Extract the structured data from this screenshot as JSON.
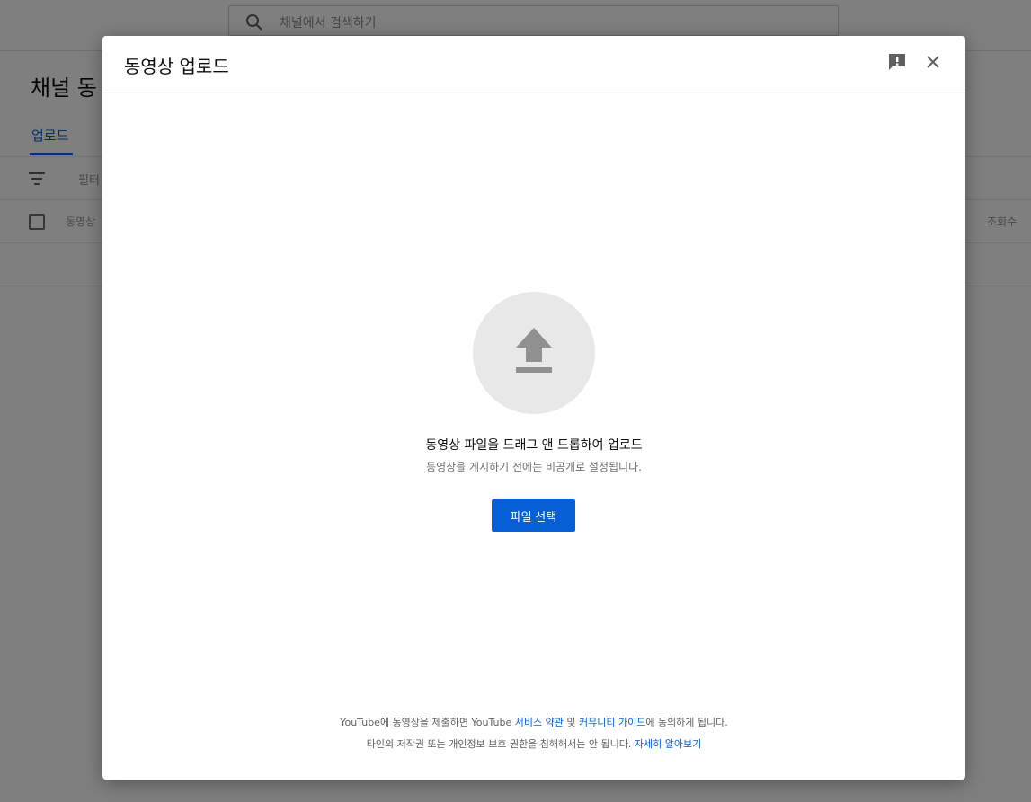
{
  "background": {
    "search_placeholder": "채널에서 검색하기",
    "page_title": "채널 동",
    "tab_upload": "업로드",
    "filter_label": "필터",
    "column_video": "동영상",
    "column_views": "조회수"
  },
  "dialog": {
    "title": "동영상 업로드",
    "drop_title": "동영상 파일을 드래그 앤 드롭하여 업로드",
    "drop_subtitle": "동영상을 게시하기 전에는 비공개로 설정됩니다.",
    "select_button": "파일 선택",
    "footer": {
      "line1_a": "YouTube에 동영상을 제출하면 YouTube ",
      "line1_link1": "서비스 약관",
      "line1_b": " 및 ",
      "line1_link2": "커뮤니티 가이드",
      "line1_c": "에 동의하게 됩니다.",
      "line2_a": "타인의 저작권 또는 개인정보 보호 권한을 침해해서는 안 됩니다. ",
      "line2_link": "자세히 알아보기"
    }
  },
  "icons": {
    "search": "search-icon",
    "filter": "filter-icon",
    "feedback": "feedback-icon",
    "close": "close-icon",
    "upload": "upload-arrow-icon"
  },
  "colors": {
    "accent": "#065fd4",
    "overlay": "rgba(0,0,0,0.5)",
    "upload_circle": "#e8e8e8"
  }
}
